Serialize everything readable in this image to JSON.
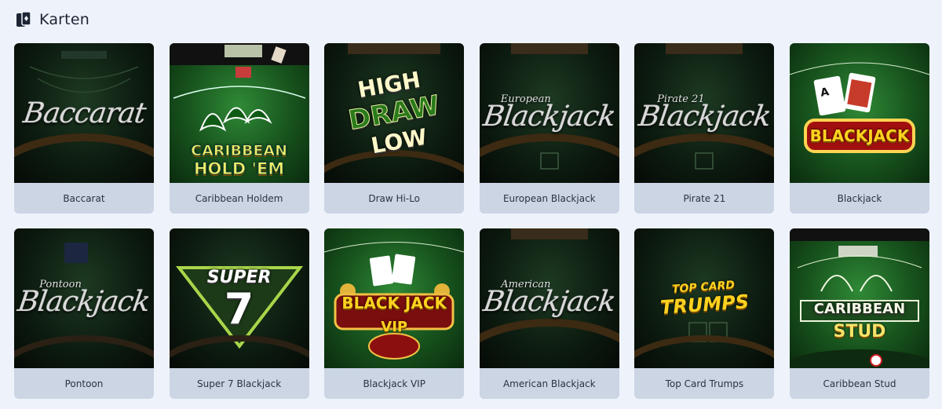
{
  "section": {
    "title": "Karten",
    "icon": "cards-icon"
  },
  "games": [
    {
      "name": "Baccarat",
      "art_text": "Baccarat",
      "style": "dark-script"
    },
    {
      "name": "Caribbean Holdem",
      "art_text_1": "CARIBBEAN",
      "art_text_2": "HOLD 'EM",
      "style": "green-cards"
    },
    {
      "name": "Draw Hi-Lo",
      "art_text_1": "HIGH",
      "art_text_2": "DRAW",
      "art_text_3": "LOW",
      "style": "dark-block"
    },
    {
      "name": "European Blackjack",
      "art_small": "European",
      "art_text": "Blackjack",
      "style": "dark-script"
    },
    {
      "name": "Pirate 21",
      "art_small": "Pirate 21",
      "art_text": "Blackjack",
      "style": "dark-script"
    },
    {
      "name": "Blackjack",
      "art_text": "BLACKJACK",
      "style": "green-badge"
    },
    {
      "name": "Pontoon",
      "art_small": "Pontoon",
      "art_text": "Blackjack",
      "style": "dark-script"
    },
    {
      "name": "Super 7 Blackjack",
      "art_text_1": "SUPER",
      "art_text_2": "7",
      "style": "dark-triangle"
    },
    {
      "name": "Blackjack VIP",
      "art_text_1": "BLACK JACK",
      "art_text_2": "VIP",
      "style": "green-vip"
    },
    {
      "name": "American Blackjack",
      "art_small": "American",
      "art_text": "Blackjack",
      "style": "dark-script"
    },
    {
      "name": "Top Card Trumps",
      "art_text_1": "TOP CARD",
      "art_text_2": "TRUMPS",
      "style": "dark-yellow"
    },
    {
      "name": "Caribbean Stud",
      "art_text_1": "CARIBBEAN",
      "art_text_2": "STUD",
      "style": "green-stud"
    }
  ],
  "colors": {
    "background": "#eef3fb",
    "label_bg": "#ccd5e4",
    "felt_dark": "#0c1a0f",
    "felt_bright": "#2f8a36",
    "accent_yellow": "#ffd21f"
  }
}
